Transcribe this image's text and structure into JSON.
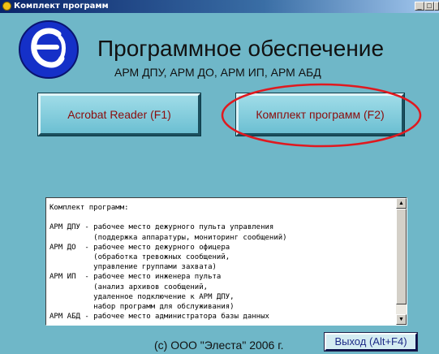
{
  "window": {
    "title": "Комплект программ",
    "controls": [
      "_",
      "□",
      "x"
    ]
  },
  "header": {
    "title": "Программное обеспечение",
    "subtitle": "АРМ ДПУ, АРМ ДО, АРМ ИП, АРМ АБД"
  },
  "buttons": {
    "acrobat": "Acrobat Reader (F1)",
    "kit": "Комплект программ (F2)",
    "exit": "Выход (Alt+F4)"
  },
  "description": {
    "text": "Комплект программ:\n\nАРМ ДПУ - рабочее место дежурного пульта управления\n          (поддержка аппаратуры, мониторинг сообщений)\nАРМ ДО  - рабочее место дежурного офицера\n          (обработка тревожных сообщений,\n          управление группами захвата)\nАРМ ИП  - рабочее место инженера пульта\n          (анализ архивов сообщений,\n          удаленное подключение к АРМ ДПУ,\n          набор программ для обслуживания)\nАРМ АБД - рабочее место администратора базы данных"
  },
  "footer": {
    "copyright": "(c) ООО \"Элеста\" 2006 г."
  },
  "colors": {
    "background": "#6fb7c8",
    "button_text": "#8b0c0c",
    "annotation": "#e0191f",
    "logo": "#1530c8"
  },
  "icons": {
    "logo": "elesta-logo",
    "title": "app-icon"
  }
}
